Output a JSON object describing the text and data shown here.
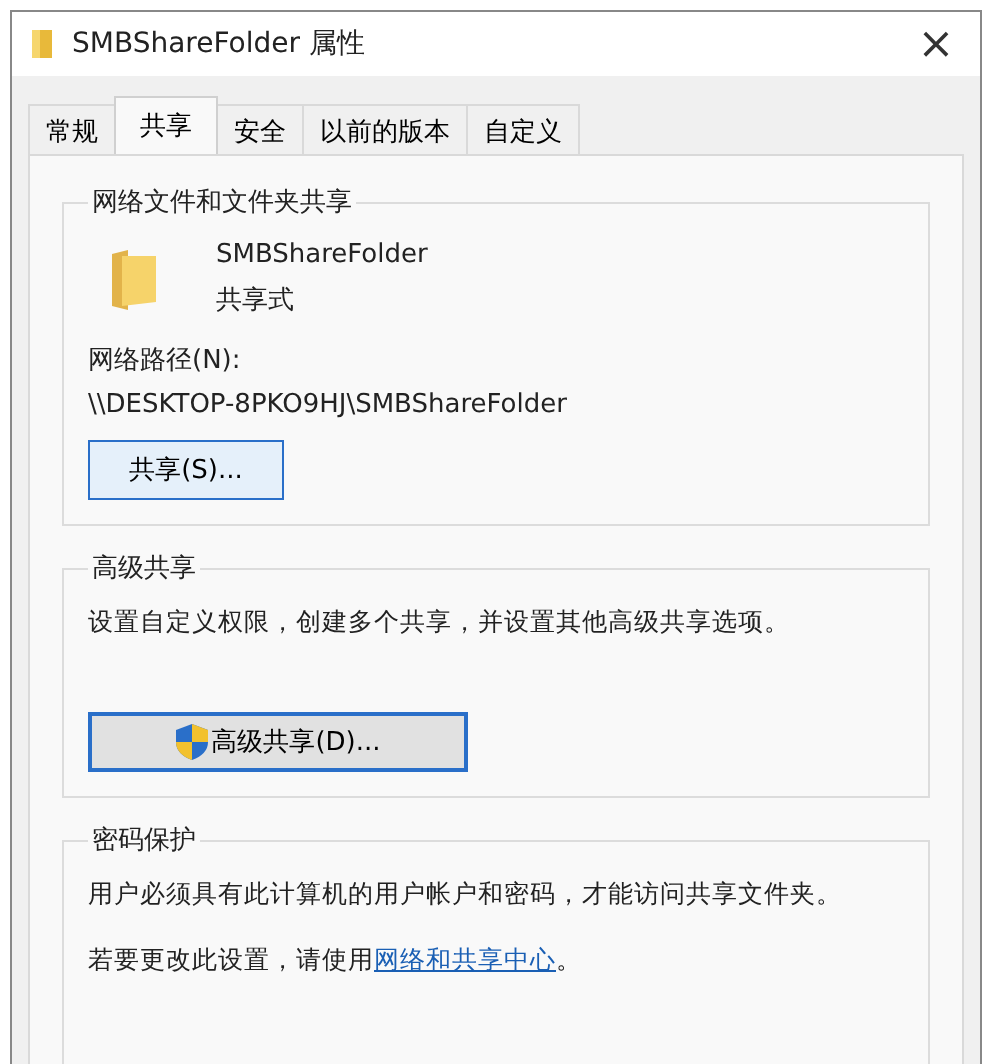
{
  "window": {
    "title": "SMBShareFolder 属性",
    "close": "×"
  },
  "tabs": [
    {
      "label": "常规",
      "selected": false
    },
    {
      "label": "共享",
      "selected": true
    },
    {
      "label": "安全",
      "selected": false
    },
    {
      "label": "以前的版本",
      "selected": false
    },
    {
      "label": "自定义",
      "selected": false
    }
  ],
  "network_sharing": {
    "title": "网络文件和文件夹共享",
    "folder_name": "SMBShareFolder",
    "folder_status": "共享式",
    "path_label": "网络路径(N):",
    "path": "\\\\DESKTOP-8PKO9HJ\\SMBShareFolder",
    "button": "共享(S)..."
  },
  "advanced_sharing": {
    "title": "高级共享",
    "description": "设置自定义权限，创建多个共享，并设置其他高级共享选项。",
    "button": "高级共享(D)..."
  },
  "password_protection": {
    "title": "密码保护",
    "description": "用户必须具有此计算机的用户帐户和密码，才能访问共享文件夹。",
    "note_prefix": "若要更改此设置，请使用",
    "note_link": "网络和共享中心",
    "note_suffix": "。"
  }
}
